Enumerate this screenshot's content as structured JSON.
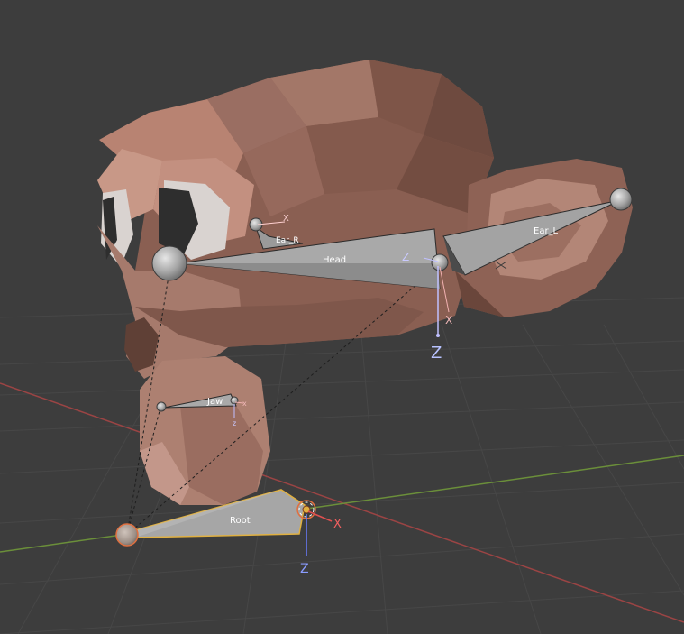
{
  "viewport": {
    "background": "#3d3d3d",
    "grid_color": "#474747",
    "x_axis_color": "#9b4444",
    "y_axis_color": "#6b8f3a",
    "mesh": "monkey-head"
  },
  "bones": [
    {
      "id": "head",
      "label": "Head"
    },
    {
      "id": "ear_l",
      "label": "Ear_L"
    },
    {
      "id": "ear_r",
      "label": "Ear_R"
    },
    {
      "id": "jaw",
      "label": "Jaw"
    },
    {
      "id": "root",
      "label": "Root",
      "selected": true
    }
  ],
  "axes": {
    "head": {
      "x": "X",
      "z": "Z",
      "z_small": "Z"
    },
    "ear_r": {
      "x": "X"
    },
    "jaw": {
      "x": "x",
      "z": "z"
    },
    "root": {
      "x": "X",
      "z": "Z"
    }
  },
  "colors": {
    "bone_fill": "#a9a9a9",
    "bone_dark": "#5e5e5e",
    "selected_outline": "#e0b040",
    "axis_x_label": "#f0b7b7",
    "axis_z_label": "#b8c2ff",
    "axis_z_small_label": "#c9c9ff"
  }
}
